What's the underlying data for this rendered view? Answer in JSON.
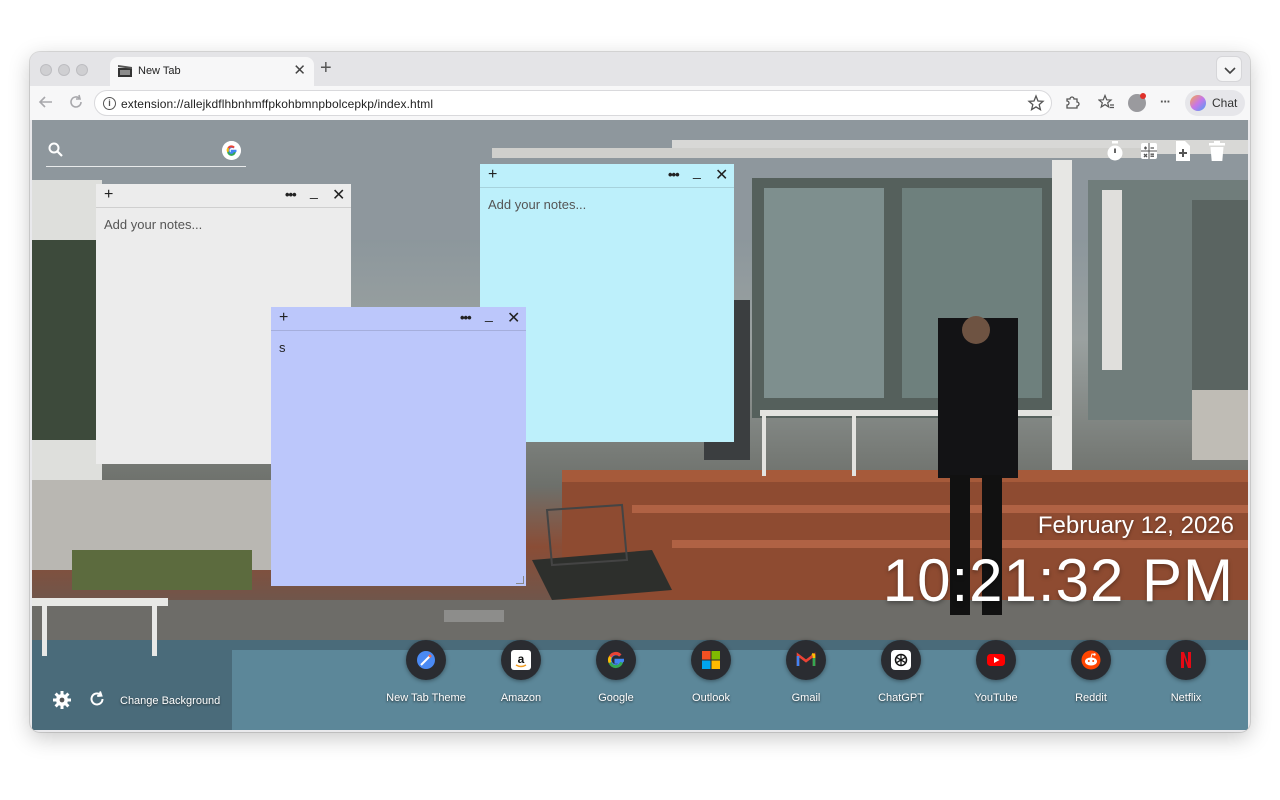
{
  "browser": {
    "tab_title": "New Tab",
    "new_tab_symbol": "+",
    "close_symbol": "✕",
    "url": "extension://allejkdflhbnhmffpkohbmnpbolcepkp/index.html",
    "chat_label": "Chat",
    "more_symbol": "···"
  },
  "top_tools": [
    "timer-icon",
    "calculator-icon",
    "add-note-icon",
    "trash-icon"
  ],
  "notes": [
    {
      "name": "note-gray",
      "color": "#ececec",
      "placeholder": "Add your notes...",
      "content": ""
    },
    {
      "name": "note-cyan",
      "color": "#bdf0fb",
      "placeholder": "Add your notes...",
      "content": ""
    },
    {
      "name": "note-purple",
      "color": "#bcc7fb",
      "placeholder": "Add your notes...",
      "content": "s"
    }
  ],
  "note_controls": {
    "add": "+",
    "more": "•••",
    "minimize": "_",
    "close": "✕"
  },
  "clock": {
    "date": "February 12, 2026",
    "time": "10:21:32 PM"
  },
  "shortcuts": [
    {
      "label": "New Tab Theme",
      "icon": "new-tab-theme-icon"
    },
    {
      "label": "Amazon",
      "icon": "amazon-icon"
    },
    {
      "label": "Google",
      "icon": "google-icon"
    },
    {
      "label": "Outlook",
      "icon": "outlook-icon"
    },
    {
      "label": "Gmail",
      "icon": "gmail-icon"
    },
    {
      "label": "ChatGPT",
      "icon": "chatgpt-icon"
    },
    {
      "label": "YouTube",
      "icon": "youtube-icon"
    },
    {
      "label": "Reddit",
      "icon": "reddit-icon"
    },
    {
      "label": "Netflix",
      "icon": "netflix-icon"
    }
  ],
  "footer": {
    "change_background_label": "Change Background"
  }
}
